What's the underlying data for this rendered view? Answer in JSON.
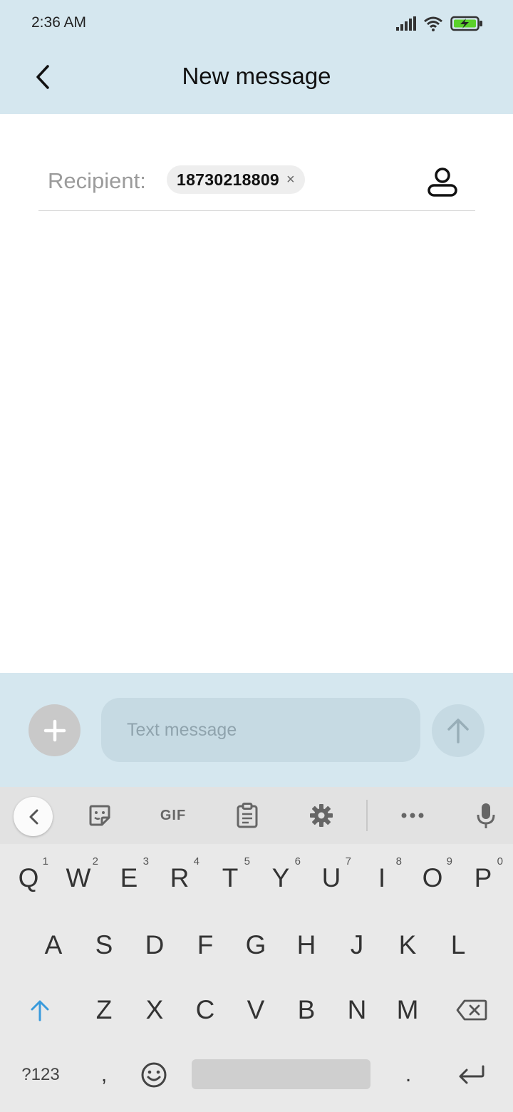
{
  "status_bar": {
    "time": "2:36 AM"
  },
  "header": {
    "title": "New message"
  },
  "recipient": {
    "label": "Recipient:",
    "number": "18730218809",
    "remove": "×"
  },
  "compose": {
    "placeholder": "Text message"
  },
  "keyboard": {
    "toolbar": {
      "gif": "GIF"
    },
    "row1": [
      {
        "key": "Q",
        "hint": "1"
      },
      {
        "key": "W",
        "hint": "2"
      },
      {
        "key": "E",
        "hint": "3"
      },
      {
        "key": "R",
        "hint": "4"
      },
      {
        "key": "T",
        "hint": "5"
      },
      {
        "key": "Y",
        "hint": "6"
      },
      {
        "key": "U",
        "hint": "7"
      },
      {
        "key": "I",
        "hint": "8"
      },
      {
        "key": "O",
        "hint": "9"
      },
      {
        "key": "P",
        "hint": "0"
      }
    ],
    "row2": [
      "A",
      "S",
      "D",
      "F",
      "G",
      "H",
      "J",
      "K",
      "L"
    ],
    "row3": [
      "Z",
      "X",
      "C",
      "V",
      "B",
      "N",
      "M"
    ],
    "bottom": {
      "symbols": "?123",
      "comma": ",",
      "period": "."
    }
  },
  "colors": {
    "header_bg": "#d5e7ef",
    "accent_blue": "#3a9bdc",
    "battery_green": "#5bd12a"
  }
}
